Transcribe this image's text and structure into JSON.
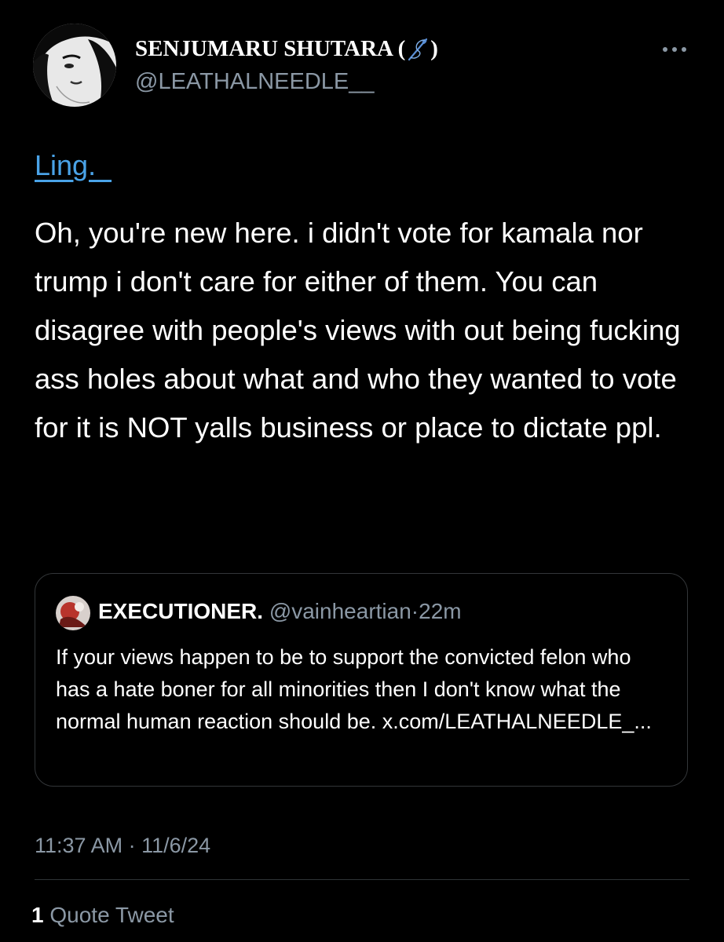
{
  "author": {
    "display_name": "SENJUMARU SHUTARA (",
    "display_name_end": ")",
    "emoji": "sewing-needle-icon",
    "handle": "@LEATHALNEEDLE__"
  },
  "tweet": {
    "reply_link": "Ling.  ",
    "text": "Oh, you're new here. i didn't vote for kamala nor trump i don't care for either of them. You can disagree with people's views with out being fucking ass holes about what and who they wanted to vote for it is NOT yalls business or place to dictate ppl."
  },
  "quote": {
    "name": "EXECUTIONER.",
    "handle": "@vainheartian",
    "separator": "·",
    "time": "22m",
    "text": "If your views happen to be to support the convicted felon who has a hate boner for all minorities then I don't know what the normal human reaction should be. x.com/LEATHALNEEDLE_..."
  },
  "meta": {
    "timestamp": "11:37 AM · 11/6/24"
  },
  "stats": {
    "quote_count": "1",
    "quote_label": "Quote Tweet"
  },
  "colors": {
    "background": "#000000",
    "text_primary": "#ffffff",
    "text_secondary": "#8b98a5",
    "link": "#4aa3e8",
    "border": "#333639"
  }
}
